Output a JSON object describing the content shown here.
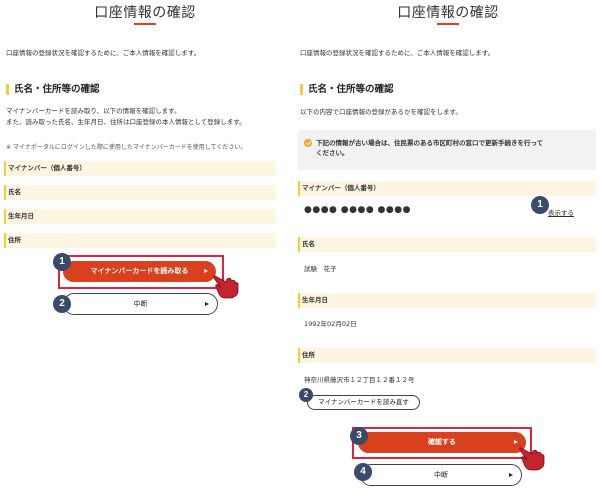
{
  "left": {
    "title": "口座情報の確認",
    "intro": "口座情報の登録状況を確認するために、ご本人情報を確認します。",
    "section_title": "氏名・住所等の確認",
    "description_line1": "マイナンバーカードを読み取り、以下の情報を確認します。",
    "description_line2": "また、読み取った氏名、生年月日、住所は口座登録の本人情報として登録します。",
    "note": "※ マイナポータルにログインした際に使用したマイナンバーカードを使用してください。",
    "fields": [
      {
        "label": "マイナンバー（個人番号）"
      },
      {
        "label": "氏名"
      },
      {
        "label": "生年月日"
      },
      {
        "label": "住所"
      }
    ],
    "read_button_label": "マイナンバーカードを読み取る",
    "cancel_button_label": "中断",
    "steps": [
      "1",
      "2"
    ]
  },
  "right": {
    "title": "口座情報の確認",
    "intro": "口座情報の登録状況を確認するために、ご本人情報を確認します。",
    "section_title": "氏名・住所等の確認",
    "description": "以下の内容で口座情報の登録があるかを確認をします。",
    "notice_line1": "下記の情報が古い場合は、住民票のある市区町村の窓口で更新手続きを行って",
    "notice_line2": "ください。",
    "fields": [
      {
        "label": "マイナンバー（個人番号）",
        "value": "●●●● ●●●● ●●●●"
      },
      {
        "label": "氏名",
        "value": "試験　花子"
      },
      {
        "label": "生年月日",
        "value": "1992年02月02日"
      },
      {
        "label": "住所",
        "value": "神奈川県藤沢市１２丁目１２番１２号"
      }
    ],
    "show_link": "表示する",
    "reread_button_label": "マイナンバーカードを読み直す",
    "confirm_button_label": "確認する",
    "cancel_button_label": "中断",
    "steps": [
      "1",
      "2",
      "3",
      "4"
    ]
  },
  "colors": {
    "accent": "#d8401e",
    "highlight": "#d8273a",
    "step_badge": "#3a4a6b",
    "field_bg": "#fdf5e1",
    "field_marker": "#f3cd3b"
  }
}
